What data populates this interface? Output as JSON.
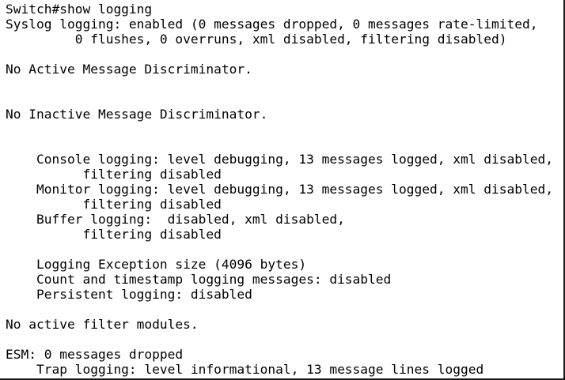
{
  "terminal": {
    "lines": [
      "Switch#show logging",
      "Syslog logging: enabled (0 messages dropped, 0 messages rate-limited,",
      "         0 flushes, 0 overruns, xml disabled, filtering disabled)",
      "",
      "No Active Message Discriminator.",
      "",
      "",
      "No Inactive Message Discriminator.",
      "",
      "",
      "    Console logging: level debugging, 13 messages logged, xml disabled,",
      "          filtering disabled",
      "    Monitor logging: level debugging, 13 messages logged, xml disabled,",
      "          filtering disabled",
      "    Buffer logging:  disabled, xml disabled,",
      "          filtering disabled",
      "",
      "    Logging Exception size (4096 bytes)",
      "    Count and timestamp logging messages: disabled",
      "    Persistent logging: disabled",
      "",
      "No active filter modules.",
      "",
      "ESM: 0 messages dropped",
      "    Trap logging: level informational, 13 message lines logged"
    ]
  }
}
